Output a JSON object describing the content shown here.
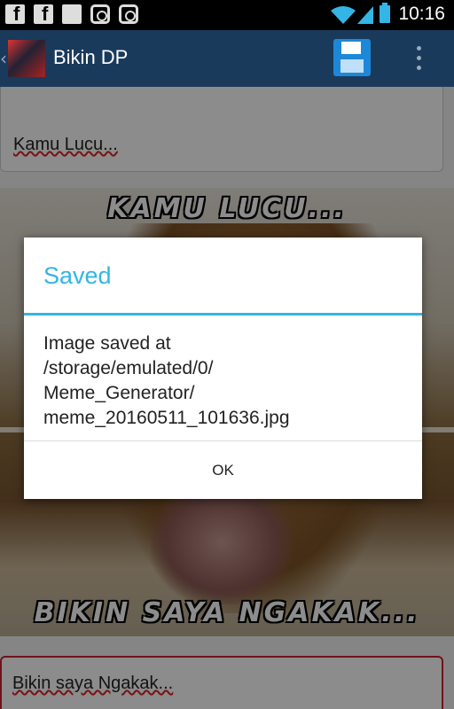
{
  "status_bar": {
    "time": "10:16",
    "notification_icons": [
      "facebook-icon",
      "facebook-icon",
      "gmail-icon",
      "instagram-icon",
      "instagram-icon"
    ],
    "signal_icons": [
      "wifi-icon",
      "cell-signal-icon",
      "battery-icon"
    ]
  },
  "action_bar": {
    "title": "Bikin DP",
    "back_symbol": "‹",
    "save_icon": "floppy-disk-icon",
    "overflow_icon": "more-vertical-icon"
  },
  "editor": {
    "top_text_value": "Kamu Lucu...",
    "bottom_text_value": "Bikin saya Ngakak..."
  },
  "meme": {
    "top_caption": "KAMU LUCU...",
    "bottom_caption": "BIKIN SAYA NGAKAK..."
  },
  "dialog": {
    "title": "Saved",
    "message_lines": [
      "Image saved at",
      "/storage/emulated/0/",
      "Meme_Generator/",
      "meme_20160511_101636.jpg"
    ],
    "ok_label": "OK"
  },
  "colors": {
    "accent": "#33b5e5",
    "action_bar": "#1a3a5c",
    "save_button": "#1e88d8",
    "error_underline": "#d22"
  }
}
